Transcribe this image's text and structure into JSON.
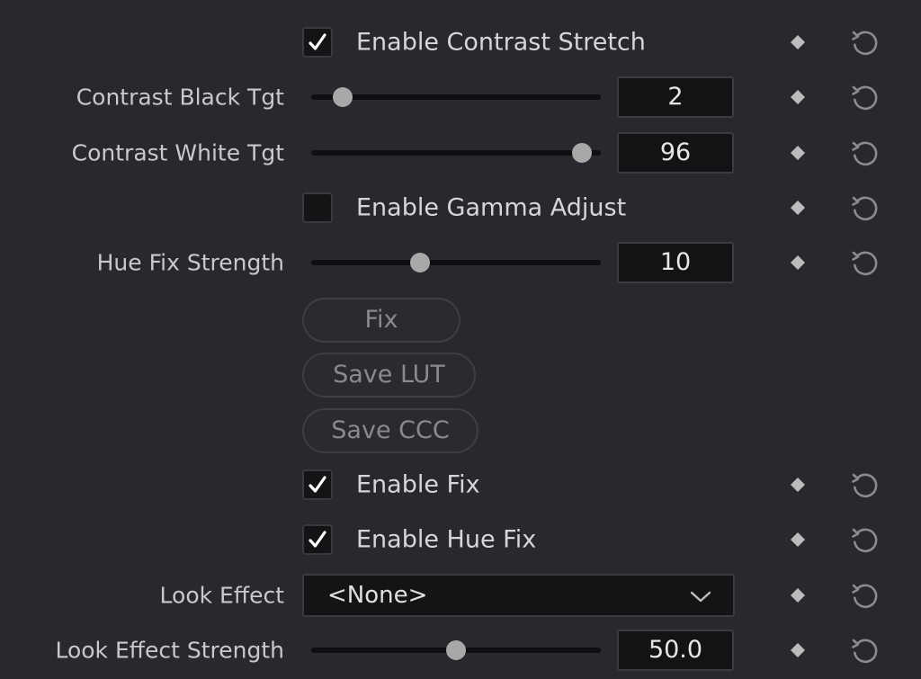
{
  "colors": {
    "background": "#28282e",
    "field_background": "#131315",
    "slider_track": "#0f0f11",
    "slider_thumb": "#a8a8a8",
    "keyframe_icon": "#bcbcbc",
    "reset_icon": "#8c8c8c",
    "checkmark": "#ffffff"
  },
  "rows": {
    "enable_contrast_stretch": {
      "label": "Enable Contrast Stretch",
      "checked": true
    },
    "contrast_black_tgt": {
      "label": "Contrast Black Tgt",
      "value": "2",
      "slider_fraction": 0.11
    },
    "contrast_white_tgt": {
      "label": "Contrast White Tgt",
      "value": "96",
      "slider_fraction": 0.935
    },
    "enable_gamma_adjust": {
      "label": "Enable Gamma Adjust",
      "checked": false
    },
    "hue_fix_strength": {
      "label": "Hue Fix Strength",
      "value": "10",
      "slider_fraction": 0.375
    },
    "enable_fix": {
      "label": "Enable Fix",
      "checked": true
    },
    "enable_hue_fix": {
      "label": "Enable Hue Fix",
      "checked": true
    },
    "look_effect": {
      "label": "Look Effect",
      "selected": "<None>"
    },
    "look_effect_strength": {
      "label": "Look Effect Strength",
      "value": "50.0",
      "slider_fraction": 0.5
    }
  },
  "buttons": {
    "fix": "Fix",
    "save_lut": "Save LUT",
    "save_ccc": "Save CCC"
  },
  "icons": {
    "keyframe": "diamond-icon",
    "reset": "reset-arrow-icon",
    "checkmark": "checkmark-icon",
    "dropdown": "chevron-down-icon"
  }
}
